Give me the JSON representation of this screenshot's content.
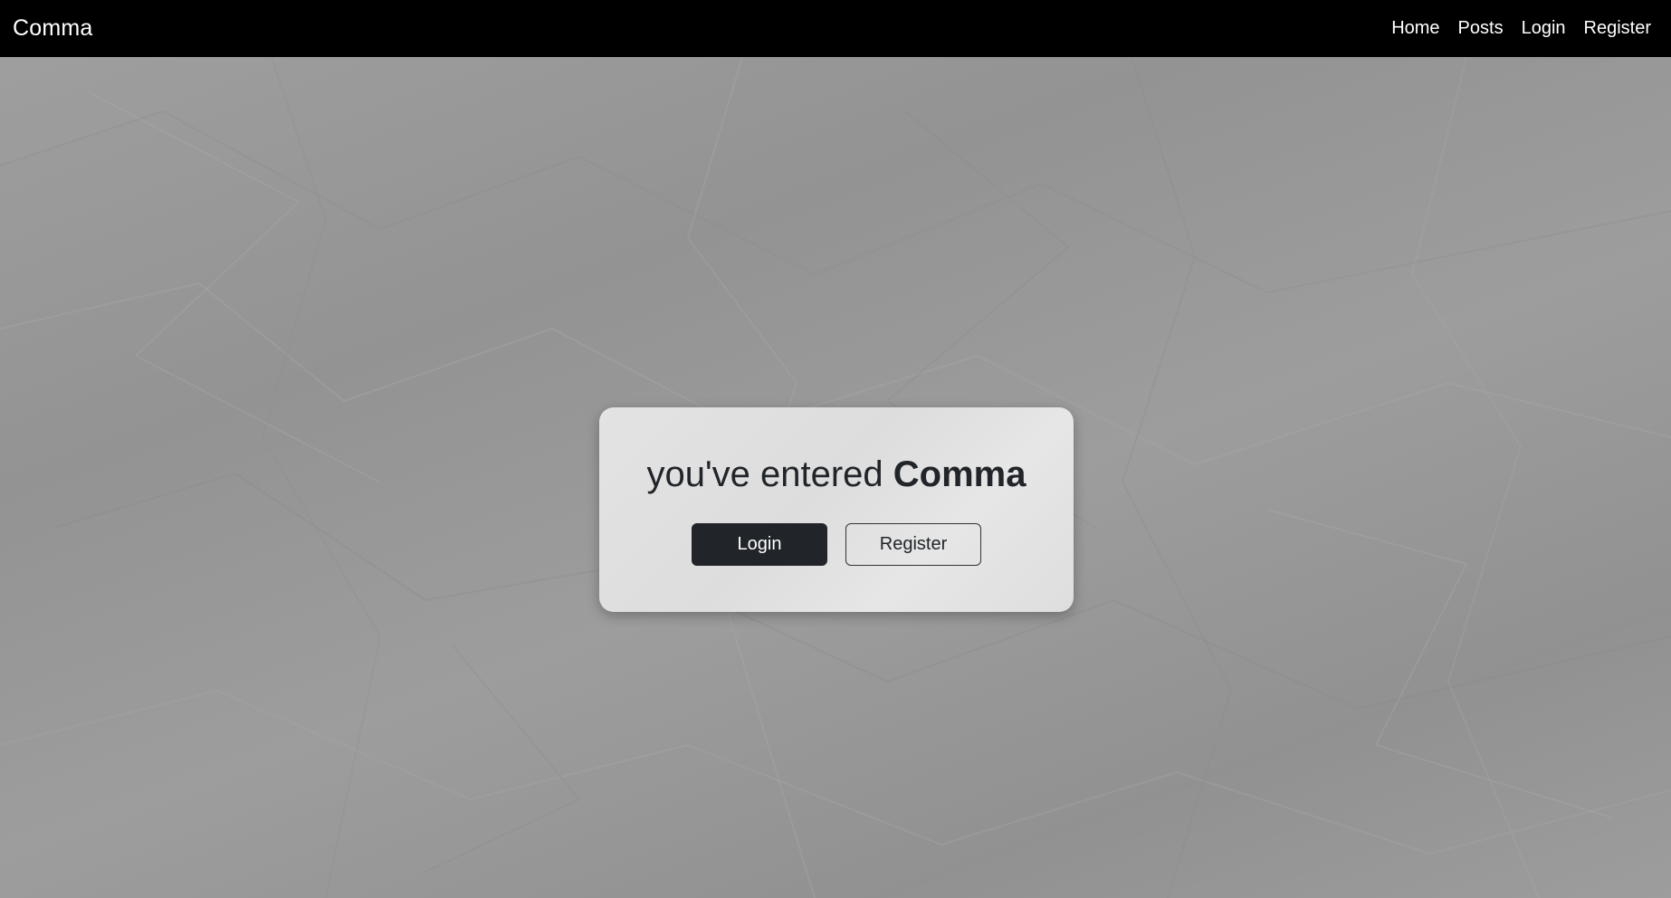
{
  "navbar": {
    "brand": "Comma",
    "links": [
      {
        "label": "Home"
      },
      {
        "label": "Posts"
      },
      {
        "label": "Login"
      },
      {
        "label": "Register"
      }
    ]
  },
  "card": {
    "title_prefix": "you've entered ",
    "title_strong": "Comma",
    "login_label": "Login",
    "register_label": "Register"
  },
  "colors": {
    "navbar_bg": "#000000",
    "page_bg": "#999999",
    "card_bg": "#e0e0e0",
    "button_dark": "#212529"
  }
}
